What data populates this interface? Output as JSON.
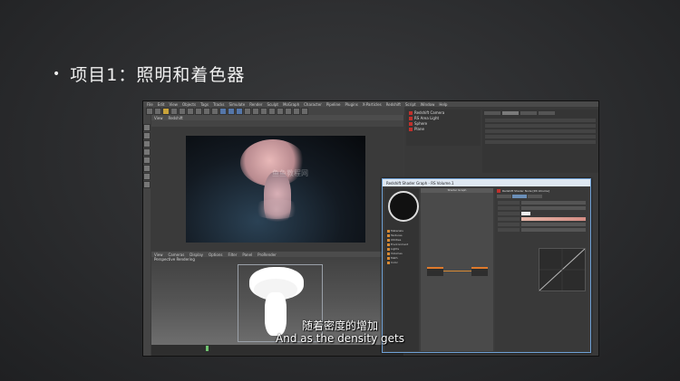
{
  "slide": {
    "bullet": "•",
    "title": "项目1：照明和着色器"
  },
  "app": {
    "menu": [
      "File",
      "Edit",
      "View",
      "Objects",
      "Tags",
      "Tracks",
      "Simulate",
      "Render",
      "Sculpt",
      "MoGraph",
      "Character",
      "Pipeline",
      "Plugins",
      "X-Particles",
      "Redshift",
      "Script",
      "Window",
      "Help"
    ],
    "viewport_top": {
      "menu": [
        "View",
        "Redshift"
      ],
      "watermark": "鱼鱼教程网"
    },
    "viewport_bottom": {
      "label": "Perspective Rendering",
      "menu": [
        "View",
        "Cameras",
        "Display",
        "Options",
        "Filter",
        "Panel",
        "ProRender"
      ]
    },
    "object_manager": {
      "items": [
        "Redshift Camera",
        "RS Area Light",
        "Sphere",
        "Plane"
      ]
    },
    "shader_graph": {
      "title": "Redshift Shader Graph - RS Volume.1",
      "graph_header": "Shader Graph",
      "node_input": "RS Volume",
      "node_output": "Output",
      "material_list": [
        "Materials",
        "Textures",
        "Utilities",
        "Environment",
        "Lights",
        "Volumes",
        "Math",
        "Color"
      ],
      "attr_header": "Redshift Shader Node [RS Volume]"
    }
  },
  "subtitles": {
    "cn": "随着密度的增加",
    "en": "And as the density gets"
  },
  "colors": {
    "accent_orange": "#d88a34",
    "window_border": "#6fa1d6",
    "tag_red": "#c0302c"
  }
}
